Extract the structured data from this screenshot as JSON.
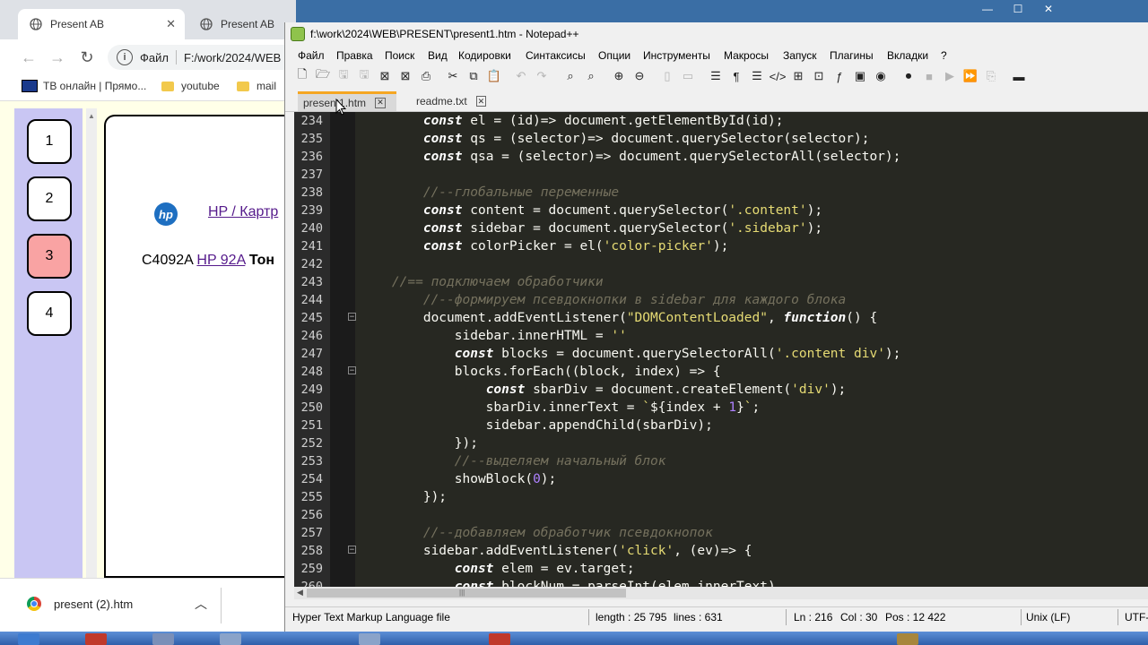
{
  "chrome": {
    "tabs": [
      {
        "label": "Present AB"
      },
      {
        "label": "Present AB"
      }
    ],
    "address": {
      "prefix": "Файл",
      "url": "F:/work/2024/WEB"
    },
    "bookmarks": [
      {
        "label": "ТВ онлайн | Прямо..."
      },
      {
        "label": "youtube"
      },
      {
        "label": "mail"
      }
    ],
    "page": {
      "buttons": [
        "1",
        "2",
        "3",
        "4"
      ],
      "selected_index": 2,
      "link": "HP / Картр",
      "product": {
        "code": "C4092A",
        "link": "HP 92A",
        "bold": "Тон"
      }
    },
    "download": {
      "name": "present (2).htm"
    }
  },
  "npp": {
    "title": "f:\\work\\2024\\WEB\\PRESENT\\present1.htm - Notepad++",
    "menu": [
      "Файл",
      "Правка",
      "Поиск",
      "Вид",
      "Кодировки",
      "Синтаксисы",
      "Опции",
      "Инструменты",
      "Макросы",
      "Запуск",
      "Плагины",
      "Вкладки",
      "?"
    ],
    "file_tabs": [
      {
        "label": "present1.htm",
        "active": true
      },
      {
        "label": "readme.txt",
        "active": false
      }
    ],
    "status": {
      "type": "Hyper Text Markup Language file",
      "length": "length : 25 795",
      "lines": "lines : 631",
      "ln": "Ln : 216",
      "col": "Col : 30",
      "pos": "Pos : 12 422",
      "eol": "Unix (LF)",
      "enc": "UTF-"
    },
    "code_lines": [
      {
        "n": "234",
        "fold": "",
        "html": "        <span class=\"kw\">const</span> el = (id)=> document.getElementById(id);"
      },
      {
        "n": "235",
        "fold": "",
        "html": "        <span class=\"kw\">const</span> qs = (selector)=> document.querySelector(selector);"
      },
      {
        "n": "236",
        "fold": "",
        "html": "        <span class=\"kw\">const</span> qsa = (selector)=> document.querySelectorAll(selector);"
      },
      {
        "n": "237",
        "fold": "",
        "html": ""
      },
      {
        "n": "238",
        "fold": "",
        "html": "        <span class=\"cm\">//--глобальные переменные</span>"
      },
      {
        "n": "239",
        "fold": "",
        "html": "        <span class=\"kw\">const</span> content = document.querySelector(<span class=\"str\">'.content'</span>);"
      },
      {
        "n": "240",
        "fold": "",
        "html": "        <span class=\"kw\">const</span> sidebar = document.querySelector(<span class=\"str\">'.sidebar'</span>);"
      },
      {
        "n": "241",
        "fold": "",
        "html": "        <span class=\"kw\">const</span> colorPicker = el(<span class=\"str\">'color-picker'</span>);"
      },
      {
        "n": "242",
        "fold": "",
        "html": ""
      },
      {
        "n": "243",
        "fold": "",
        "html": "    <span class=\"cm\">//== подключаем обработчики</span>"
      },
      {
        "n": "244",
        "fold": "",
        "html": "        <span class=\"cm\">//--формируем псевдокнопки в sidebar для каждого блока</span>"
      },
      {
        "n": "245",
        "fold": "−",
        "html": "        document.addEventListener(<span class=\"str\">\"DOMContentLoaded\"</span>, <span class=\"kw\">function</span>() {"
      },
      {
        "n": "246",
        "fold": "",
        "html": "            sidebar.innerHTML = <span class=\"str\">''</span>"
      },
      {
        "n": "247",
        "fold": "",
        "html": "            <span class=\"kw\">const</span> blocks = document.querySelectorAll(<span class=\"str\">'.content div'</span>);"
      },
      {
        "n": "248",
        "fold": "−",
        "html": "            blocks.forEach((block, index) => {"
      },
      {
        "n": "249",
        "fold": "",
        "html": "                <span class=\"kw\">const</span> sbarDiv = document.createElement(<span class=\"str\">'div'</span>);"
      },
      {
        "n": "250",
        "fold": "",
        "html": "                sbarDiv.innerText = <span class=\"str\">`</span>${index + <span class=\"num\">1</span>}<span class=\"str\">`</span>;"
      },
      {
        "n": "251",
        "fold": "",
        "html": "                sidebar.appendChild(sbarDiv);"
      },
      {
        "n": "252",
        "fold": "",
        "html": "            });"
      },
      {
        "n": "253",
        "fold": "",
        "html": "            <span class=\"cm\">//--выделяем начальный блок</span>"
      },
      {
        "n": "254",
        "fold": "",
        "html": "            showBlock(<span class=\"num\">0</span>);"
      },
      {
        "n": "255",
        "fold": "",
        "html": "        });"
      },
      {
        "n": "256",
        "fold": "",
        "html": ""
      },
      {
        "n": "257",
        "fold": "",
        "html": "        <span class=\"cm\">//--добавляем обработчик псевдокнопок</span>"
      },
      {
        "n": "258",
        "fold": "−",
        "html": "        sidebar.addEventListener(<span class=\"str\">'click'</span>, (ev)=> {"
      },
      {
        "n": "259",
        "fold": "",
        "html": "            <span class=\"kw\">const</span> elem = ev.target;"
      },
      {
        "n": "260",
        "fold": "",
        "html": "            <span class=\"kw\">const</span> blockNum = parseInt(elem.innerText)"
      }
    ]
  }
}
